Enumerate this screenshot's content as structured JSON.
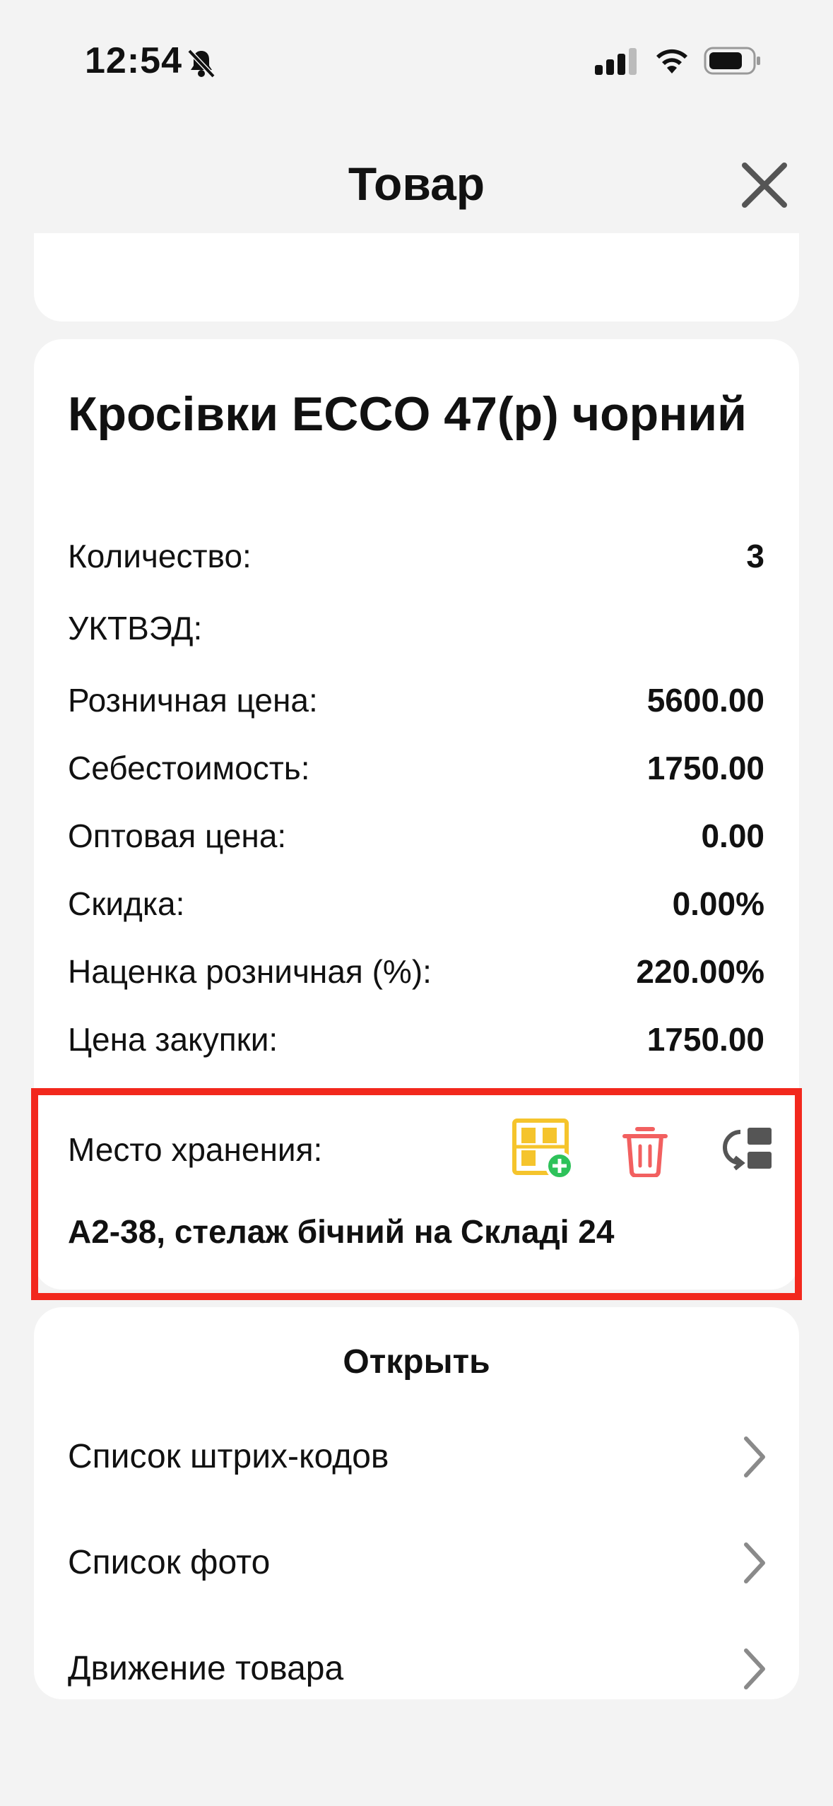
{
  "status_bar": {
    "time": "12:54",
    "icons": [
      "bell-slash-icon",
      "signal-icon",
      "wifi-icon",
      "battery-icon"
    ]
  },
  "header": {
    "title": "Товар",
    "close_icon": "close-icon"
  },
  "product": {
    "name": "Кросівки ECCO 47(р) чорний",
    "fields": [
      {
        "label": "Количество:",
        "value": "3"
      },
      {
        "label": "УКТВЭД:",
        "value": ""
      },
      {
        "label": "Розничная цена:",
        "value": "5600.00"
      },
      {
        "label": "Себестоимость:",
        "value": "1750.00"
      },
      {
        "label": "Оптовая цена:",
        "value": "0.00"
      },
      {
        "label": "Скидка:",
        "value": "0.00%"
      },
      {
        "label": "Наценка розничная (%):",
        "value": "220.00%"
      },
      {
        "label": "Цена закупки:",
        "value": "1750.00"
      }
    ],
    "storage": {
      "label": "Место хранения:",
      "value": "А2-38, стелаж бічний на Складі 24",
      "actions": [
        "add-storage-icon",
        "trash-icon",
        "move-storage-icon"
      ]
    }
  },
  "open_section": {
    "title": "Открыть",
    "items": [
      {
        "label": "Список штрих-кодов"
      },
      {
        "label": "Список фото"
      },
      {
        "label": "Движение товара"
      }
    ]
  },
  "colors": {
    "background": "#f3f3f3",
    "card": "#ffffff",
    "highlight": "#f2281d",
    "add_icon": "#f5c42c",
    "add_plus": "#2ec25a",
    "trash": "#f26060",
    "icon_gray": "#555555"
  }
}
